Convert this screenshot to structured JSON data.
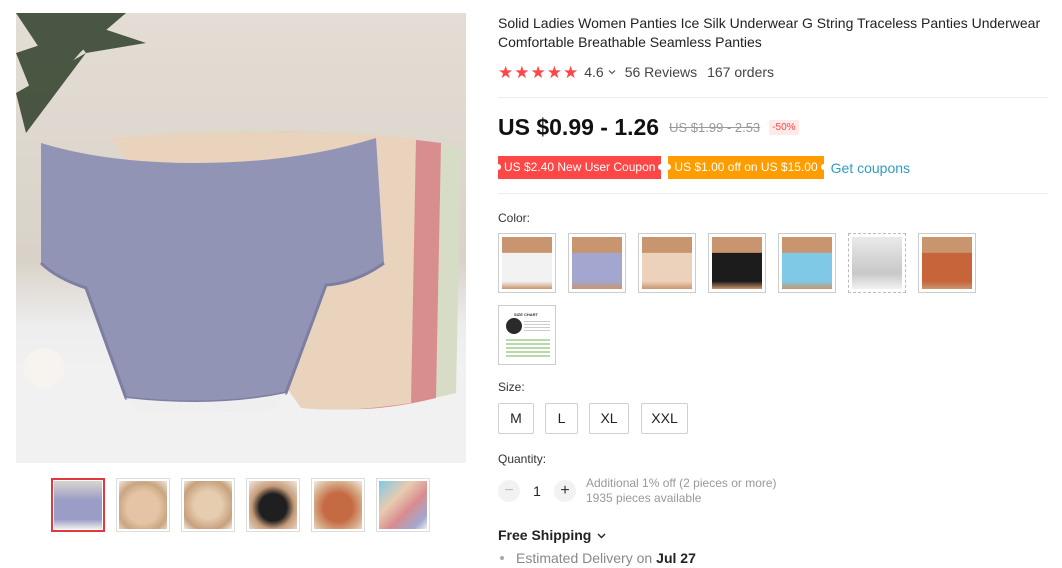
{
  "product": {
    "title": "Solid Ladies Women Panties Ice Silk Underwear G String Traceless Panties Underwear Comfortable Breathable Seamless Panties",
    "rating": "4.6",
    "reviews": "56 Reviews",
    "orders": "167 orders",
    "price": "US $0.99 - 1.26",
    "old_price": "US $1.99 - 2.53",
    "discount": "-50%",
    "coupons": {
      "new_user": "US $2.40 New User Coupon",
      "store": "US $1.00 off on US $15.00",
      "link": "Get coupons"
    },
    "color_label": "Color:",
    "colors": [
      {
        "name": "white",
        "hex": "#f2f2f2"
      },
      {
        "name": "purple",
        "hex": "#a3a6cf"
      },
      {
        "name": "skin",
        "hex": "#e9cbb0"
      },
      {
        "name": "black",
        "hex": "#1c1c1c"
      },
      {
        "name": "blue",
        "hex": "#7fc8e6"
      },
      {
        "name": "gray",
        "hex": "#d6d6d6"
      },
      {
        "name": "orange",
        "hex": "#c8643a"
      },
      {
        "name": "size-chart",
        "hex": "#ffffff"
      }
    ],
    "size_chart_text": "SIZE CHART",
    "size_label": "Size:",
    "sizes": [
      "M",
      "L",
      "XL",
      "XXL"
    ],
    "quantity_label": "Quantity:",
    "quantity": "1",
    "qty_minus": "−",
    "qty_plus": "+",
    "qty_note_1": "Additional 1% off (2 pieces or more)",
    "qty_note_2": "1935 pieces available",
    "shipping": "Free Shipping",
    "delivery_label": "Estimated Delivery on",
    "delivery_date": "Jul 27"
  },
  "gallery": {
    "thumbnails": [
      {
        "name": "purple",
        "hex": "#9a9dc6"
      },
      {
        "name": "skin",
        "hex": "#e4c4a4"
      },
      {
        "name": "beige",
        "hex": "#e6cdb0"
      },
      {
        "name": "black",
        "hex": "#1f1f1f"
      },
      {
        "name": "orange",
        "hex": "#c56a42"
      },
      {
        "name": "mixed",
        "hex": "#c9a6b4"
      }
    ],
    "active_index": 0
  },
  "colors": {
    "accent": "#ff4747",
    "coupon_orange": "#ff9c00",
    "link_blue": "#2e9cc3"
  }
}
